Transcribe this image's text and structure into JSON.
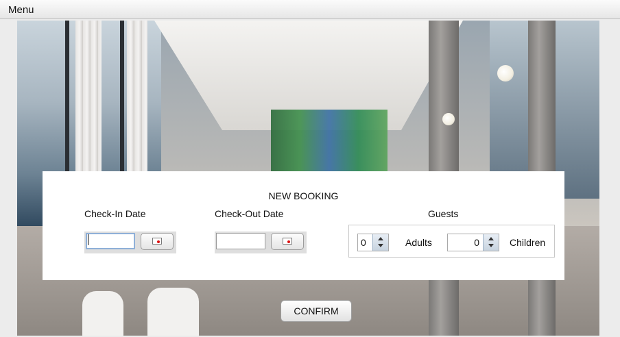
{
  "menubar": {
    "menu_label": "Menu"
  },
  "booking": {
    "title": "NEW BOOKING",
    "check_in": {
      "label": "Check-In Date",
      "value": ""
    },
    "check_out": {
      "label": "Check-Out Date",
      "value": ""
    },
    "guests": {
      "label": "Guests",
      "adults": {
        "value": "0",
        "label": "Adults"
      },
      "children": {
        "value": "0",
        "label": "Children"
      }
    },
    "icons": {
      "calendar": "calendar-icon",
      "spinner_up": "chevron-up-icon",
      "spinner_down": "chevron-down-icon"
    }
  },
  "actions": {
    "confirm_label": "CONFIRM"
  }
}
